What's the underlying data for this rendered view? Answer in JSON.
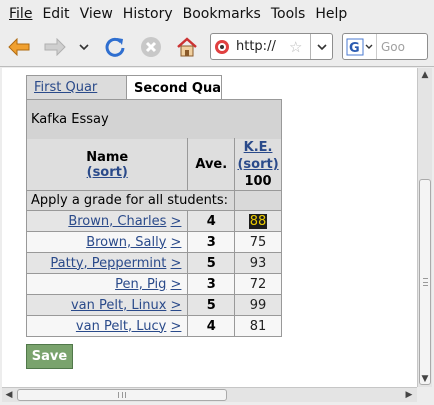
{
  "menubar": {
    "items": [
      "File",
      "Edit",
      "View",
      "History",
      "Bookmarks",
      "Tools",
      "Help"
    ]
  },
  "toolbar": {
    "url": "http://",
    "search_placeholder": "Goo"
  },
  "tabs": [
    {
      "label": "First Quar",
      "active": false
    },
    {
      "label": "Second Qua",
      "active": true
    }
  ],
  "assignment": {
    "title": "Kafka Essay"
  },
  "table": {
    "name_header": "Name",
    "name_sort": "(sort)",
    "ave_header": "Ave.",
    "ke_header": "K.E.",
    "ke_sort": "(sort)",
    "ke_max": "100",
    "apply_all_label": "Apply a grade for all students:",
    "rows": [
      {
        "name": "Brown, Charles",
        "link": ">",
        "ave": "4",
        "grade": "88"
      },
      {
        "name": "Brown, Sally",
        "link": ">",
        "ave": "3",
        "grade": "75"
      },
      {
        "name": "Patty, Peppermint",
        "link": ">",
        "ave": "5",
        "grade": "93"
      },
      {
        "name": "Pen, Pig",
        "link": ">",
        "ave": "3",
        "grade": "72"
      },
      {
        "name": "van Pelt, Linux",
        "link": ">",
        "ave": "5",
        "grade": "99"
      },
      {
        "name": "van Pelt, Lucy",
        "link": ">",
        "ave": "4",
        "grade": "81"
      }
    ]
  },
  "save_label": "Save"
}
